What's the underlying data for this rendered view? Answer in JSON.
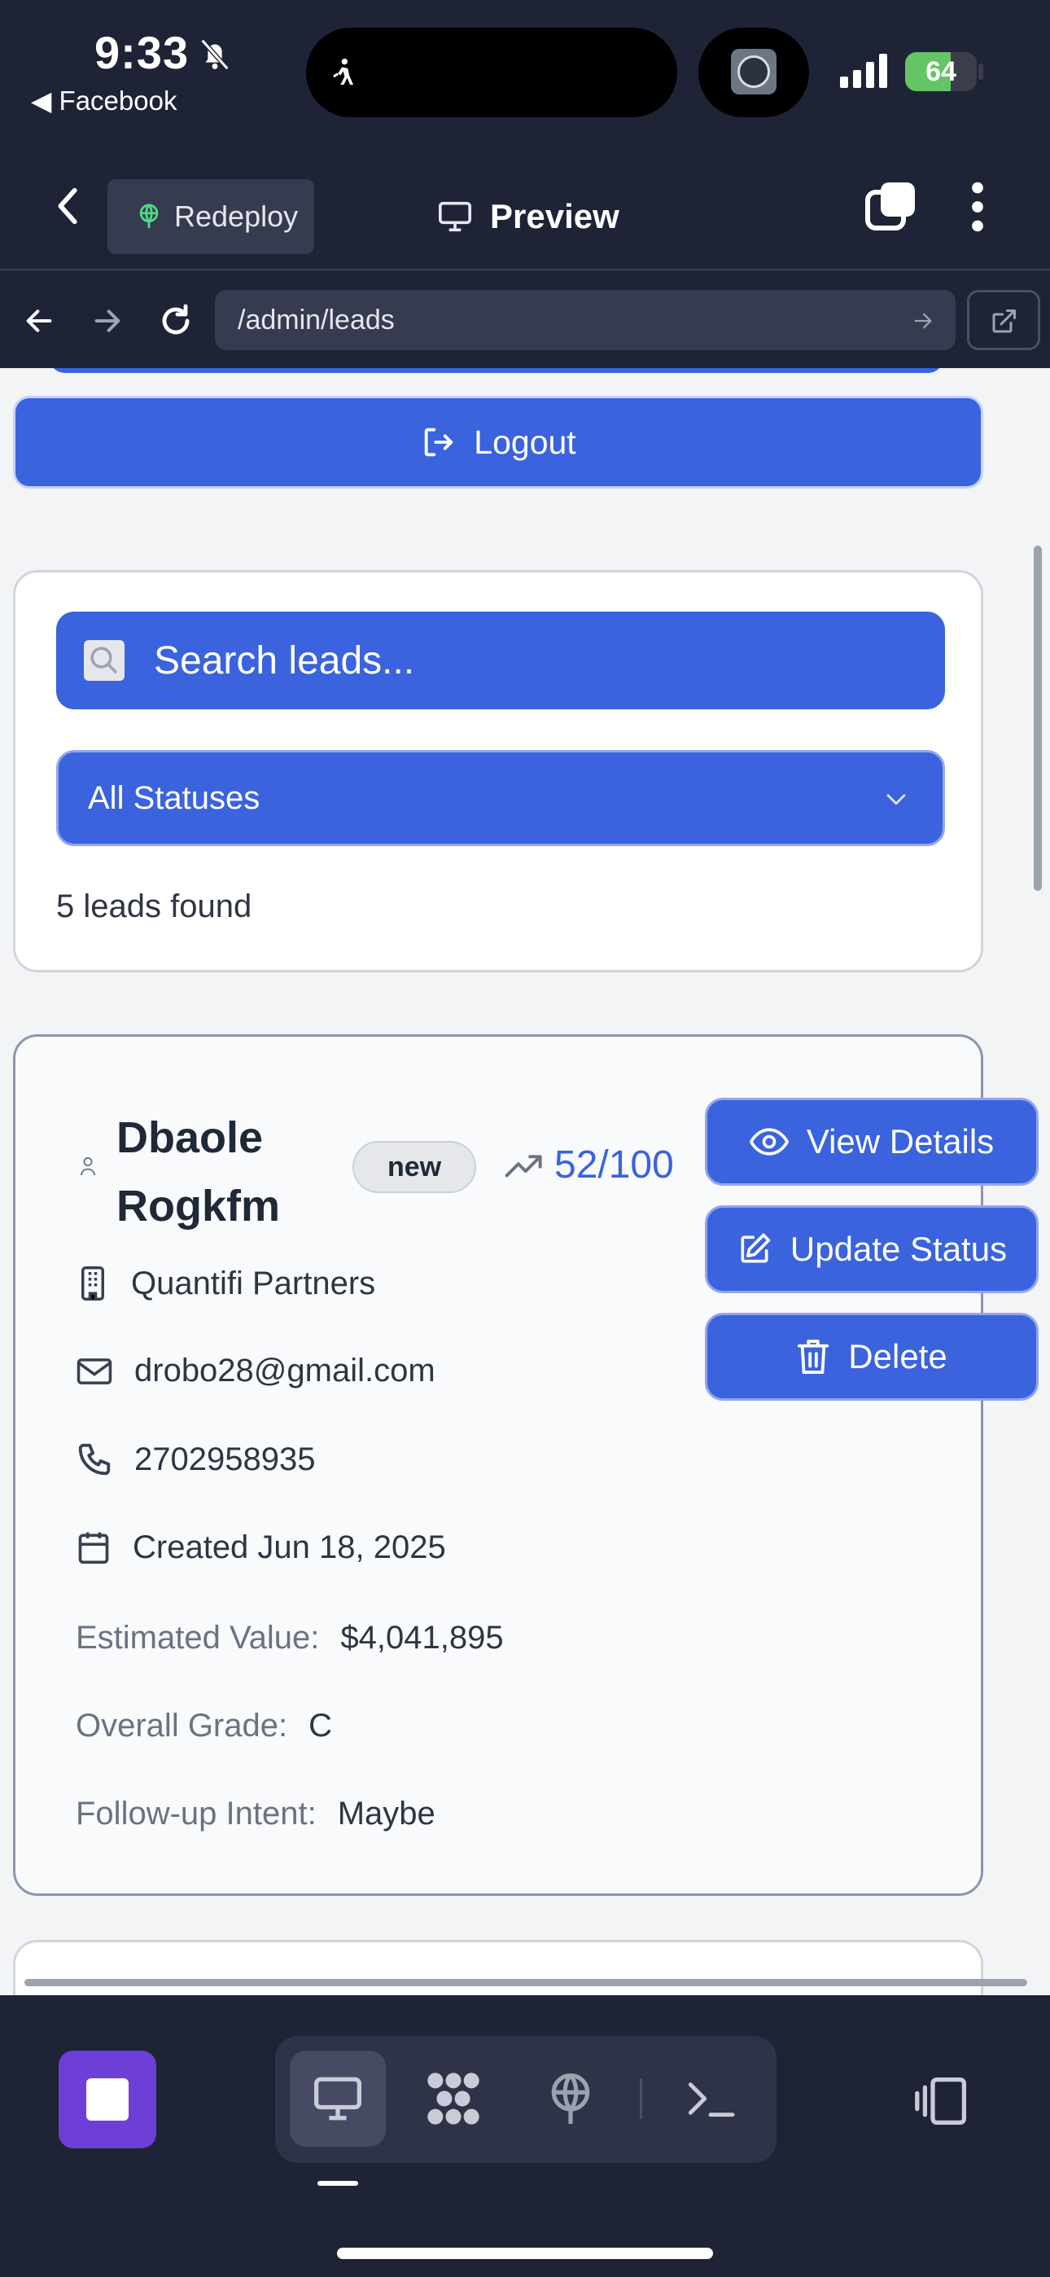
{
  "status_bar": {
    "time": "9:33",
    "back_app": "◀ Facebook",
    "battery": "64",
    "battery_level": 0.64
  },
  "app_header": {
    "redeploy_label": "Redeploy",
    "preview_label": "Preview"
  },
  "url_bar": {
    "url": "/admin/leads"
  },
  "logout": {
    "label": "Logout"
  },
  "filters": {
    "search_placeholder": "Search leads...",
    "status_selected": "All Statuses",
    "leads_count": "5 leads found"
  },
  "lead": {
    "name": "Dbaole Rogkfm",
    "status_badge": "new",
    "score": "52/100",
    "company": "Quantifi Partners",
    "email": "drobo28@gmail.com",
    "phone": "2702958935",
    "created": "Created Jun 18, 2025",
    "estimated_value_label": "Estimated Value:",
    "estimated_value": "$4,041,895",
    "overall_grade_label": "Overall Grade:",
    "overall_grade": "C",
    "followup_label": "Follow-up Intent:",
    "followup": "Maybe",
    "actions": {
      "view_details": "View Details",
      "update_status": "Update Status",
      "delete": "Delete"
    }
  },
  "colors": {
    "primary": "#3a63dd",
    "header_bg": "#1f2336",
    "stop_button": "#6d3fd6",
    "battery": "#64c466"
  }
}
